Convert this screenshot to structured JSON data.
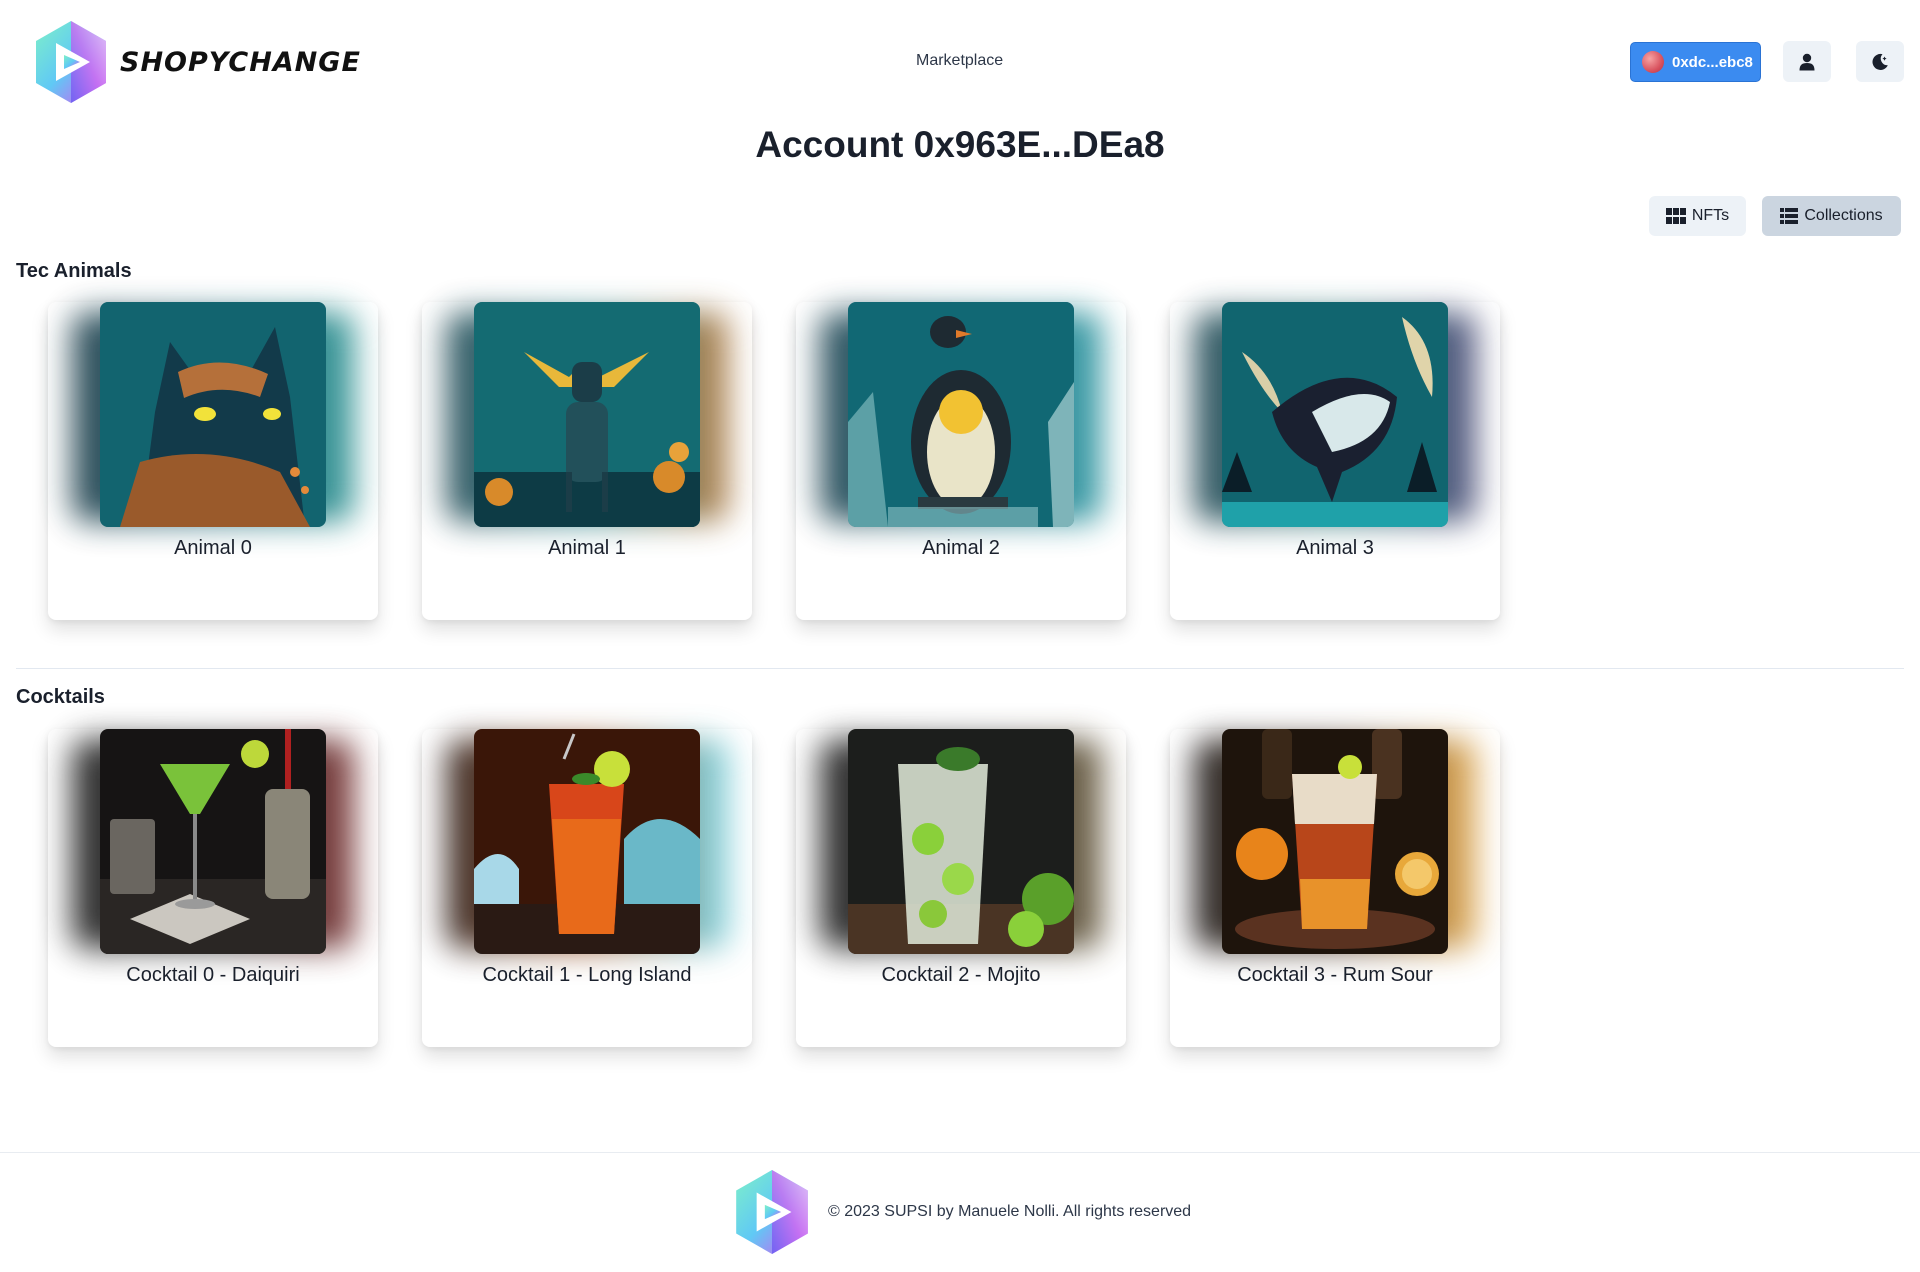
{
  "header": {
    "brand": "SHOPYCHANGE",
    "nav_link": "Marketplace",
    "wallet_label": "0xdc...ebc8",
    "icons": [
      "user-icon",
      "moon-icon"
    ]
  },
  "page": {
    "title": "Account 0x963E...DEa8"
  },
  "view_toggle": {
    "nfts_label": "NFTs",
    "collections_label": "Collections",
    "selected": "Collections"
  },
  "collections": [
    {
      "title": "Tec Animals",
      "items": [
        {
          "name": "Animal 0"
        },
        {
          "name": "Animal 1"
        },
        {
          "name": "Animal 2"
        },
        {
          "name": "Animal 3"
        }
      ]
    },
    {
      "title": "Cocktails",
      "items": [
        {
          "name": "Cocktail 0 - Daiquiri"
        },
        {
          "name": "Cocktail 1 - Long Island"
        },
        {
          "name": "Cocktail 2 - Mojito"
        },
        {
          "name": "Cocktail 3 - Rum Sour"
        }
      ]
    }
  ],
  "footer": {
    "text": "© 2023 SUPSI by Manuele Nolli. All rights reserved"
  },
  "colors": {
    "accent": "#3b8bf0",
    "button_bg": "#edf2f7",
    "button_active_bg": "#cbd5e0"
  }
}
